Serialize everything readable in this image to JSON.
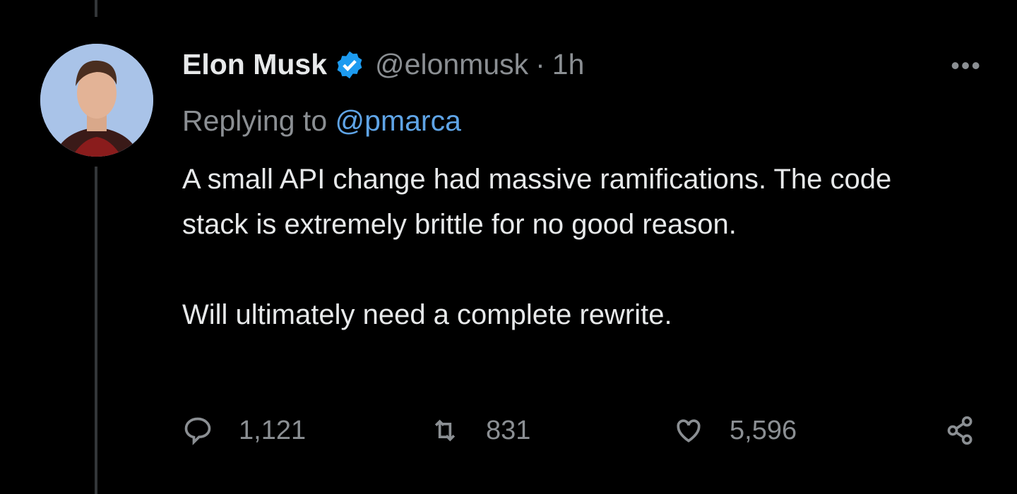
{
  "tweet": {
    "name": "Elon Musk",
    "handle": "@elonmusk",
    "separator": "·",
    "time": "1h",
    "replying_label": "Replying to",
    "replying_to": "@pmarca",
    "body": [
      "A small API change had massive ramifications. The code stack is extremely brittle for no good reason.",
      "Will ultimately need a complete rewrite."
    ],
    "more": "•••",
    "replies": "1,121",
    "retweets": "831",
    "likes": "5,596"
  },
  "colors": {
    "link": "#5fa4e6",
    "verified": "#1d9bf0",
    "muted": "#8b8f93"
  }
}
